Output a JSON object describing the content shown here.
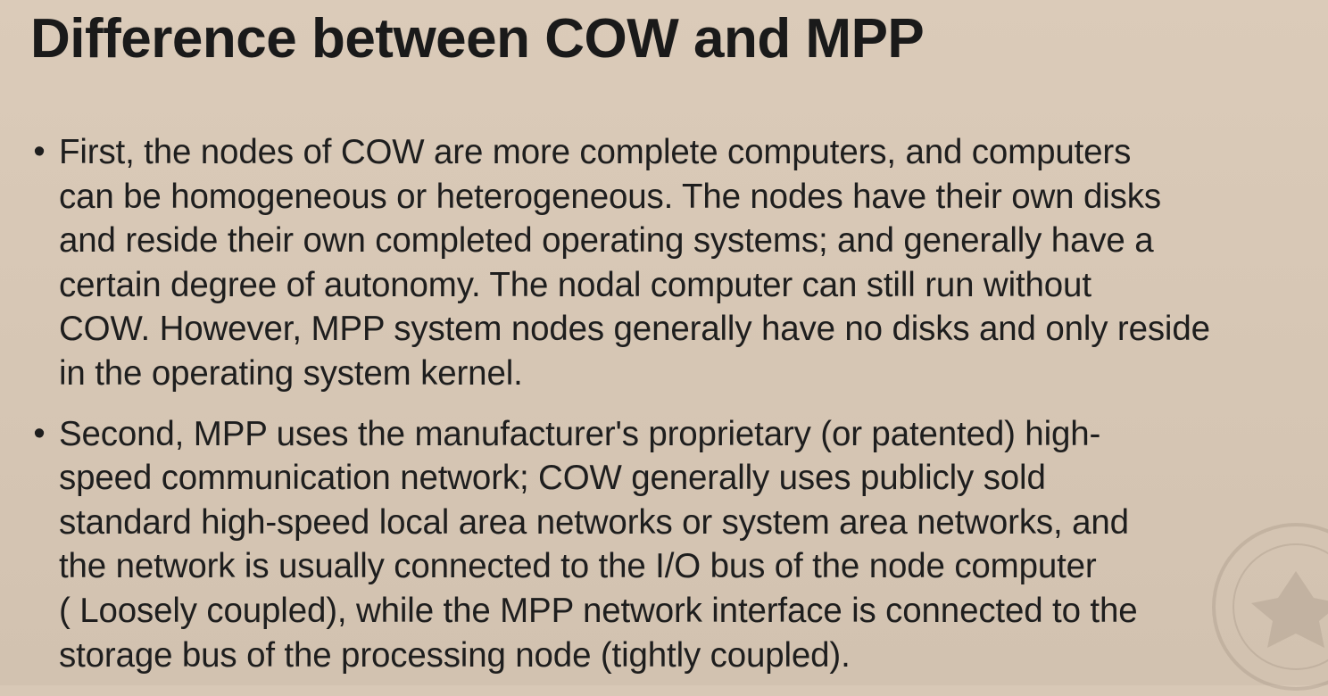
{
  "slide": {
    "title": "Difference between COW and MPP",
    "bullets": [
      {
        "lines": [
          "First, the nodes of COW are more complete computers, and computers",
          "can be homogeneous or heterogeneous. The nodes have their own disks",
          "and reside their own completed operating systems; and generally have a",
          "certain degree of autonomy. The nodal computer can still run without",
          "COW. However, MPP system nodes generally have no disks and only reside",
          "in the operating system kernel."
        ]
      },
      {
        "lines": [
          "Second, MPP uses the manufacturer's proprietary (or patented) high-",
          "speed communication network; COW generally uses publicly sold",
          "standard high-speed local area networks or system area networks, and",
          "the network is usually connected to the I/O bus of the node computer",
          "( Loosely coupled), while the MPP network interface is connected to the",
          "storage bus of the processing node (tightly coupled)."
        ]
      }
    ],
    "bullet_symbol": "•",
    "seal_icon": "university-seal-icon"
  }
}
